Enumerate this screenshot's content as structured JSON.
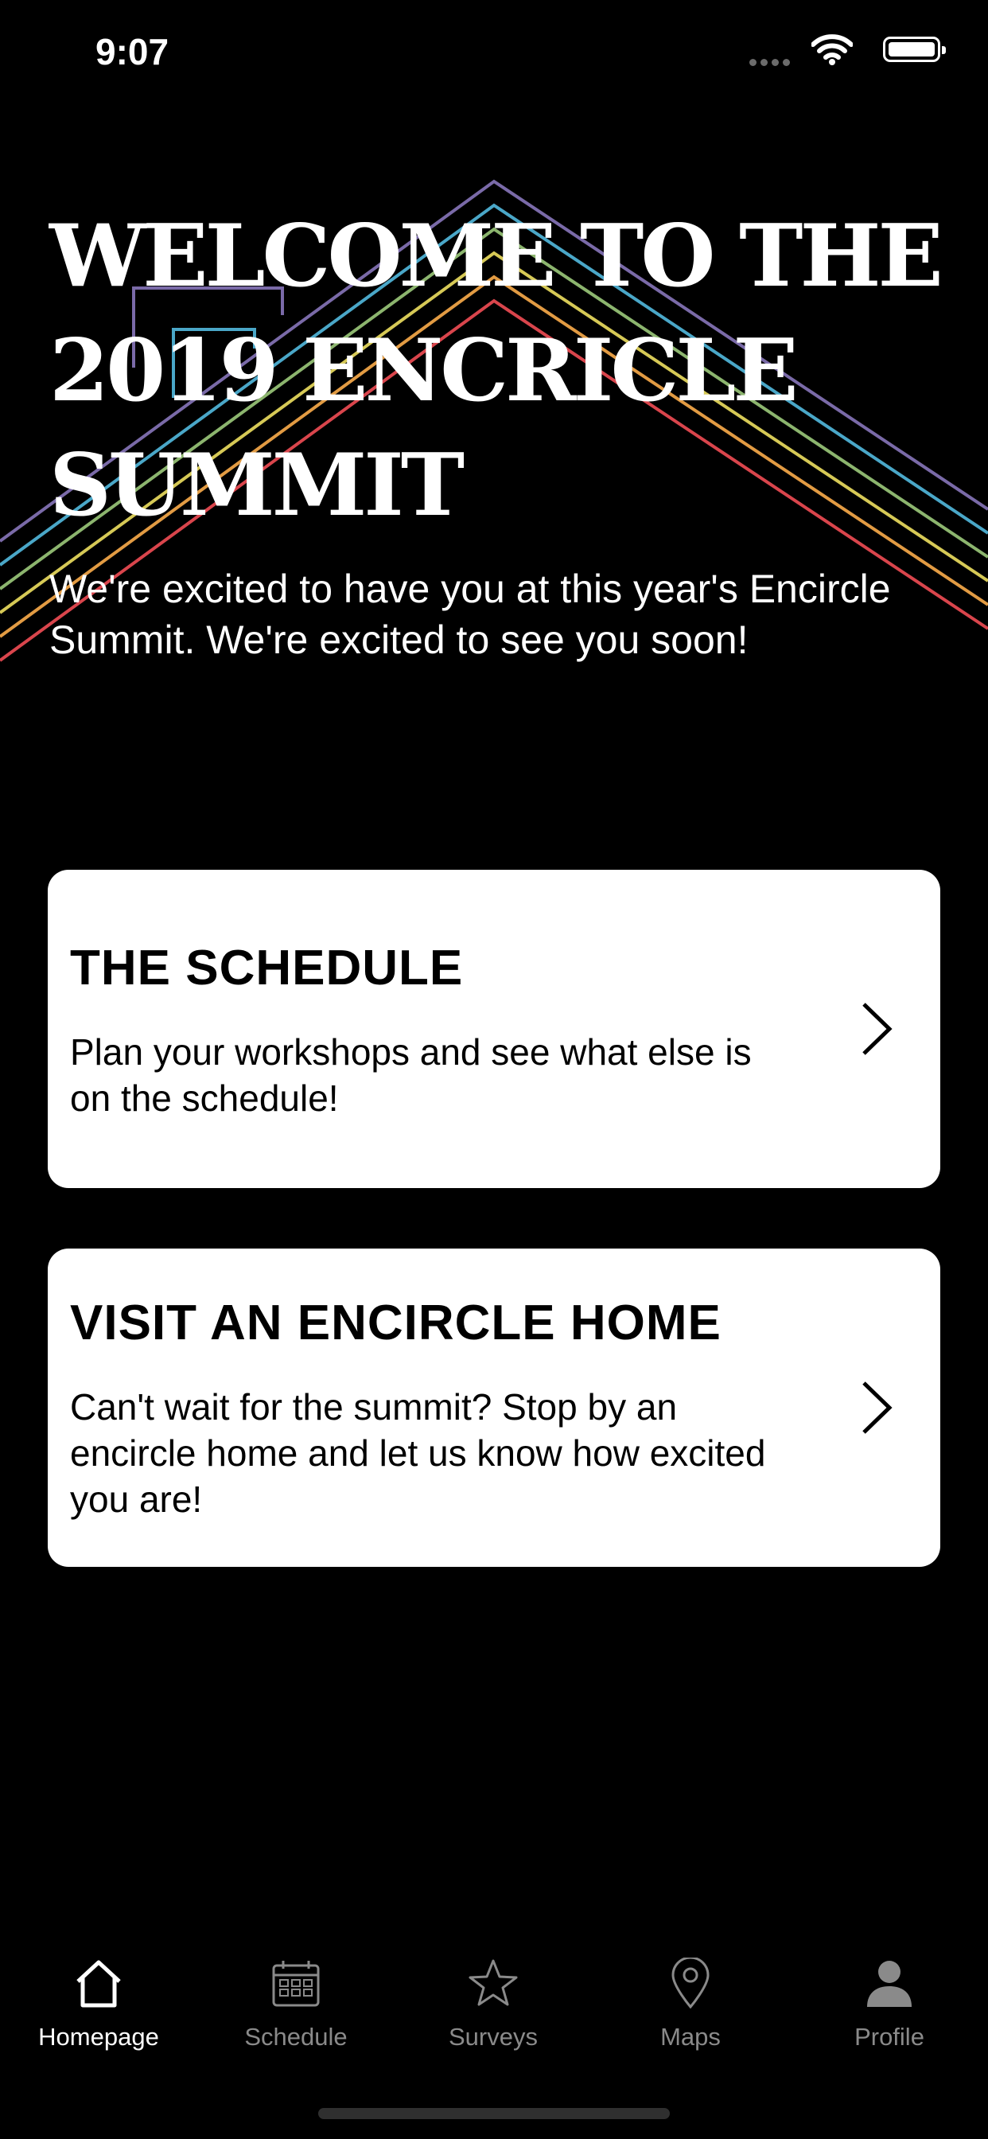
{
  "status_bar": {
    "time": "9:07"
  },
  "hero": {
    "title": "WELCOME TO THE 2019 ENCRICLE SUMMIT",
    "subtitle": "We're excited to have you at this year's Encircle Summit. We're excited to see you soon!",
    "rainbow_colors": [
      "#7a6aa8",
      "#4aa7c8",
      "#8cb56e",
      "#d6c956",
      "#e29b43",
      "#d9454c"
    ]
  },
  "cards": [
    {
      "title": "THE SCHEDULE",
      "description": "Plan  your workshops and see what else is on the schedule!"
    },
    {
      "title": "VISIT AN ENCIRCLE HOME",
      "description": "Can't wait for the summit? Stop by an encircle home and let us know how excited you are!"
    }
  ],
  "tab_bar": {
    "active_color": "#ffffff",
    "inactive_color": "#8a8a8a",
    "tabs": [
      {
        "label": "Homepage",
        "icon": "house-icon",
        "active": true
      },
      {
        "label": "Schedule",
        "icon": "calendar-icon",
        "active": false
      },
      {
        "label": "Surveys",
        "icon": "star-icon",
        "active": false
      },
      {
        "label": "Maps",
        "icon": "map-pin-icon",
        "active": false
      },
      {
        "label": "Profile",
        "icon": "person-icon",
        "active": false
      }
    ]
  }
}
